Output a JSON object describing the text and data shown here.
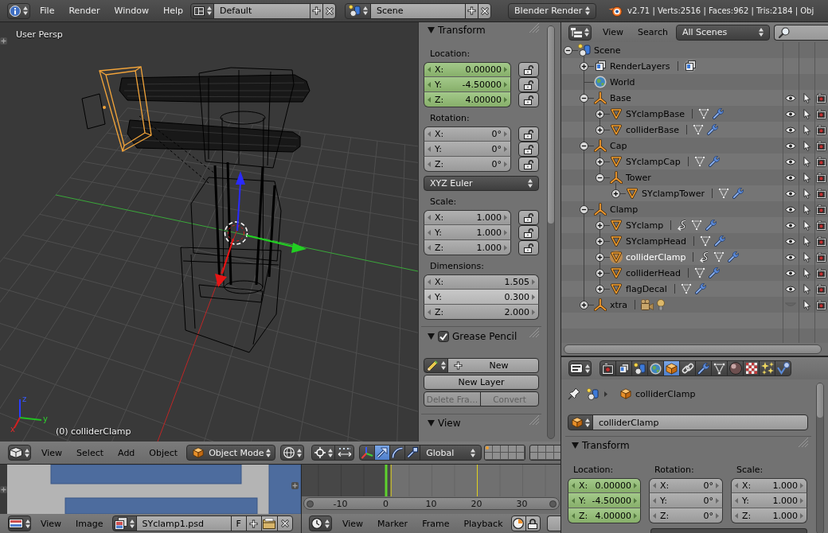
{
  "top_bar": {
    "menus": [
      "File",
      "Render",
      "Window",
      "Help"
    ],
    "screen_layout": "Default",
    "scene": "Scene",
    "render_engine": "Blender Render",
    "stats": "v2.71 | Verts:2516 | Faces:962 | Tris:2184 | Obj"
  },
  "viewport": {
    "view_name": "User Persp",
    "object_info": "(0) colliderClamp",
    "axis_labels": [
      "z",
      "y",
      "x"
    ]
  },
  "transform_panel": {
    "title": "Transform",
    "expanded": true,
    "groups": [
      {
        "kind": "vector",
        "label": "Location:",
        "keyframed": true,
        "lockable": true,
        "fields": [
          {
            "axis": "X:",
            "value": "0.00000",
            "locked": false
          },
          {
            "axis": "Y:",
            "value": "-4.50000",
            "locked": false
          },
          {
            "axis": "Z:",
            "value": "4.00000",
            "locked": false
          }
        ]
      },
      {
        "kind": "vector",
        "label": "Rotation:",
        "keyframed": false,
        "lockable": true,
        "fields": [
          {
            "axis": "X:",
            "value": "0°",
            "locked": false
          },
          {
            "axis": "Y:",
            "value": "0°",
            "locked": false
          },
          {
            "axis": "Z:",
            "value": "0°",
            "locked": false
          }
        ]
      },
      {
        "kind": "dropdown",
        "value": "XYZ Euler"
      },
      {
        "kind": "vector",
        "label": "Scale:",
        "keyframed": false,
        "lockable": true,
        "fields": [
          {
            "axis": "X:",
            "value": "1.000",
            "locked": false
          },
          {
            "axis": "Y:",
            "value": "1.000",
            "locked": false
          },
          {
            "axis": "Z:",
            "value": "1.000",
            "locked": false
          }
        ]
      },
      {
        "kind": "vector",
        "label": "Dimensions:",
        "keyframed": false,
        "lockable": false,
        "fields": [
          {
            "axis": "X:",
            "value": "1.505",
            "hovered": false
          },
          {
            "axis": "Y:",
            "value": "0.300",
            "hovered": true
          },
          {
            "axis": "Z:",
            "value": "2.000",
            "hovered": false
          }
        ]
      }
    ]
  },
  "grease_pencil_panel": {
    "title": "Grease Pencil",
    "enabled": true,
    "expanded": true,
    "new_button": "New",
    "button_rows": [
      {
        "buttons": [
          {
            "label": "New Layer",
            "disabled": false
          }
        ]
      },
      {
        "buttons": [
          {
            "label": "Delete Fra…",
            "disabled": true
          },
          {
            "label": "Convert",
            "disabled": true
          }
        ]
      }
    ]
  },
  "view_panel": {
    "title": "View",
    "expanded": true
  },
  "view3d_header": {
    "menus": [
      "View",
      "Select",
      "Add",
      "Object"
    ],
    "mode": "Object Mode",
    "manipulators": [
      {
        "kind": "toggle",
        "selected": false
      },
      {
        "kind": "translate",
        "selected": true
      },
      {
        "kind": "rotate",
        "selected": false
      },
      {
        "kind": "scale",
        "selected": false
      }
    ],
    "orientation": "Global",
    "layer_blocks": [
      {
        "layers": [
          {
            "used": true
          },
          {
            "used": false
          },
          {
            "used": false
          },
          {
            "used": false
          },
          {
            "used": false
          },
          {
            "used": false
          },
          {
            "used": false
          },
          {
            "used": false
          },
          {
            "used": false
          },
          {
            "used": false
          }
        ]
      },
      {
        "layers": [
          {
            "used": false
          },
          {
            "used": false
          },
          {
            "used": false
          },
          {
            "used": false
          },
          {
            "used": false
          },
          {
            "used": false
          },
          {
            "used": false
          },
          {
            "used": false
          }
        ]
      }
    ]
  },
  "image_editor": {
    "menus": [
      "View",
      "Image"
    ],
    "image_name": "SYclamp1.psd",
    "fake_user": "F"
  },
  "timeline": {
    "frame_labels": [
      "-10",
      "0",
      "10",
      "20",
      "30"
    ],
    "menus": [
      "View",
      "Marker",
      "Frame",
      "Playback"
    ]
  },
  "outliner": {
    "menus": [
      "View",
      "Search"
    ],
    "filter": "All Scenes",
    "tree": [
      {
        "name": "Scene",
        "kind": "scene",
        "expanded": true,
        "selected": false,
        "children": [
          {
            "name": "RenderLayers",
            "kind": "render_layers",
            "expanded": false,
            "selected": false,
            "badges": [
              {
                "kind": "render_layers"
              }
            ]
          },
          {
            "name": "World",
            "kind": "world",
            "selected": false
          },
          {
            "name": "Base",
            "kind": "empty",
            "expanded": true,
            "selected": false,
            "visible": true,
            "selectable": true,
            "renderable": true,
            "children": [
              {
                "name": "SYclampBase",
                "kind": "mesh",
                "expanded": false,
                "selected": false,
                "visible": true,
                "selectable": true,
                "renderable": true,
                "badges": [
                  {
                    "kind": "mesh_data"
                  },
                  {
                    "kind": "modifier"
                  }
                ]
              },
              {
                "name": "colliderBase",
                "kind": "mesh",
                "expanded": false,
                "selected": false,
                "visible": true,
                "selectable": true,
                "renderable": true,
                "badges": [
                  {
                    "kind": "mesh_data"
                  },
                  {
                    "kind": "modifier"
                  }
                ]
              }
            ]
          },
          {
            "name": "Cap",
            "kind": "empty",
            "expanded": true,
            "selected": false,
            "visible": true,
            "selectable": true,
            "renderable": true,
            "children": [
              {
                "name": "SYclampCap",
                "kind": "mesh",
                "expanded": false,
                "selected": false,
                "visible": true,
                "selectable": true,
                "renderable": true,
                "badges": [
                  {
                    "kind": "mesh_data"
                  },
                  {
                    "kind": "modifier"
                  }
                ]
              },
              {
                "name": "Tower",
                "kind": "empty",
                "expanded": true,
                "selected": false,
                "visible": true,
                "selectable": true,
                "renderable": true,
                "children": [
                  {
                    "name": "SYclampTower",
                    "kind": "mesh",
                    "expanded": false,
                    "selected": false,
                    "visible": true,
                    "selectable": true,
                    "renderable": true,
                    "badges": [
                      {
                        "kind": "mesh_data"
                      },
                      {
                        "kind": "modifier"
                      }
                    ]
                  }
                ]
              }
            ]
          },
          {
            "name": "Clamp",
            "kind": "empty",
            "expanded": true,
            "selected": false,
            "visible": true,
            "selectable": true,
            "renderable": true,
            "children": [
              {
                "name": "SYclamp",
                "kind": "mesh",
                "expanded": false,
                "selected": false,
                "visible": true,
                "selectable": true,
                "renderable": true,
                "badges": [
                  {
                    "kind": "link"
                  },
                  {
                    "kind": "mesh_data"
                  },
                  {
                    "kind": "modifier"
                  }
                ]
              },
              {
                "name": "SYclampHead",
                "kind": "mesh",
                "expanded": false,
                "selected": false,
                "visible": true,
                "selectable": true,
                "renderable": true,
                "badges": [
                  {
                    "kind": "mesh_data"
                  },
                  {
                    "kind": "modifier"
                  }
                ]
              },
              {
                "name": "colliderClamp",
                "kind": "mesh",
                "expanded": false,
                "selected": true,
                "visible": true,
                "selectable": true,
                "renderable": true,
                "badges": [
                  {
                    "kind": "link"
                  },
                  {
                    "kind": "mesh_data"
                  },
                  {
                    "kind": "modifier"
                  }
                ]
              },
              {
                "name": "colliderHead",
                "kind": "mesh",
                "expanded": false,
                "selected": false,
                "visible": true,
                "selectable": true,
                "renderable": true,
                "badges": [
                  {
                    "kind": "mesh_data"
                  },
                  {
                    "kind": "modifier"
                  }
                ]
              },
              {
                "name": "flagDecal",
                "kind": "mesh",
                "expanded": false,
                "selected": false,
                "visible": true,
                "selectable": true,
                "renderable": true,
                "badges": [
                  {
                    "kind": "mesh_data"
                  },
                  {
                    "kind": "modifier"
                  }
                ]
              }
            ]
          },
          {
            "name": "xtra",
            "kind": "empty",
            "expanded": false,
            "selected": false,
            "visible": false,
            "selectable": true,
            "renderable": true,
            "badges": [
              {
                "kind": "camera"
              },
              {
                "kind": "lamp"
              }
            ]
          }
        ]
      }
    ]
  },
  "properties": {
    "tabs": [
      {
        "kind": "render",
        "selected": false
      },
      {
        "kind": "render_layers",
        "selected": false
      },
      {
        "kind": "scene",
        "selected": false
      },
      {
        "kind": "world",
        "selected": false
      },
      {
        "kind": "object",
        "selected": true
      },
      {
        "kind": "constraints",
        "selected": false
      },
      {
        "kind": "modifiers",
        "selected": false
      },
      {
        "kind": "data",
        "selected": false
      },
      {
        "kind": "material",
        "selected": false
      },
      {
        "kind": "texture",
        "selected": false
      },
      {
        "kind": "particles",
        "selected": false
      },
      {
        "kind": "physics",
        "selected": false
      }
    ],
    "breadcrumb": "colliderClamp",
    "object_name": "colliderClamp",
    "transform": {
      "title": "Transform",
      "expanded": true,
      "columns": [
        {
          "label": "Location:",
          "keyframed": true,
          "fields": [
            {
              "axis": "X:",
              "value": "0.00000"
            },
            {
              "axis": "Y:",
              "value": "-4.50000"
            },
            {
              "axis": "Z:",
              "value": "4.00000"
            }
          ]
        },
        {
          "label": "Rotation:",
          "keyframed": false,
          "fields": [
            {
              "axis": "X:",
              "value": "0°"
            },
            {
              "axis": "Y:",
              "value": "0°"
            },
            {
              "axis": "Z:",
              "value": "0°"
            }
          ]
        },
        {
          "label": "Scale:",
          "keyframed": false,
          "fields": [
            {
              "axis": "X:",
              "value": "1.000"
            },
            {
              "axis": "Y:",
              "value": "1.000"
            },
            {
              "axis": "Z:",
              "value": "1.000"
            }
          ]
        }
      ]
    }
  }
}
